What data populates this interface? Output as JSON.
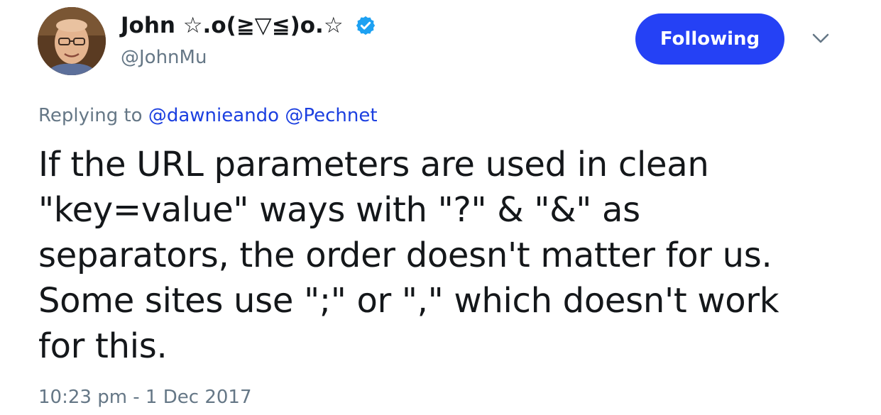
{
  "author": {
    "display_name": "John ☆.o(≧▽≦)o.☆",
    "handle": "@JohnMu",
    "verified": true
  },
  "follow_button": {
    "label": "Following"
  },
  "reply": {
    "prefix": "Replying to",
    "mentions": [
      "@dawnieando",
      "@Pechnet"
    ]
  },
  "tweet": {
    "text": "If the URL parameters are used in clean \"key=value\" ways with \"?\" & \"&\" as separators, the order doesn't matter for us. Some sites use \";\" or \",\" which doesn't work for this.",
    "timestamp": "10:23 pm - 1 Dec 2017"
  },
  "colors": {
    "follow_button_bg": "#2541f5",
    "mention_link": "#1b3fe0",
    "secondary_text": "#657786",
    "verified_badge": "#1da1f2"
  },
  "icons": {
    "verified": "verified-badge-icon",
    "menu": "chevron-down-icon"
  }
}
